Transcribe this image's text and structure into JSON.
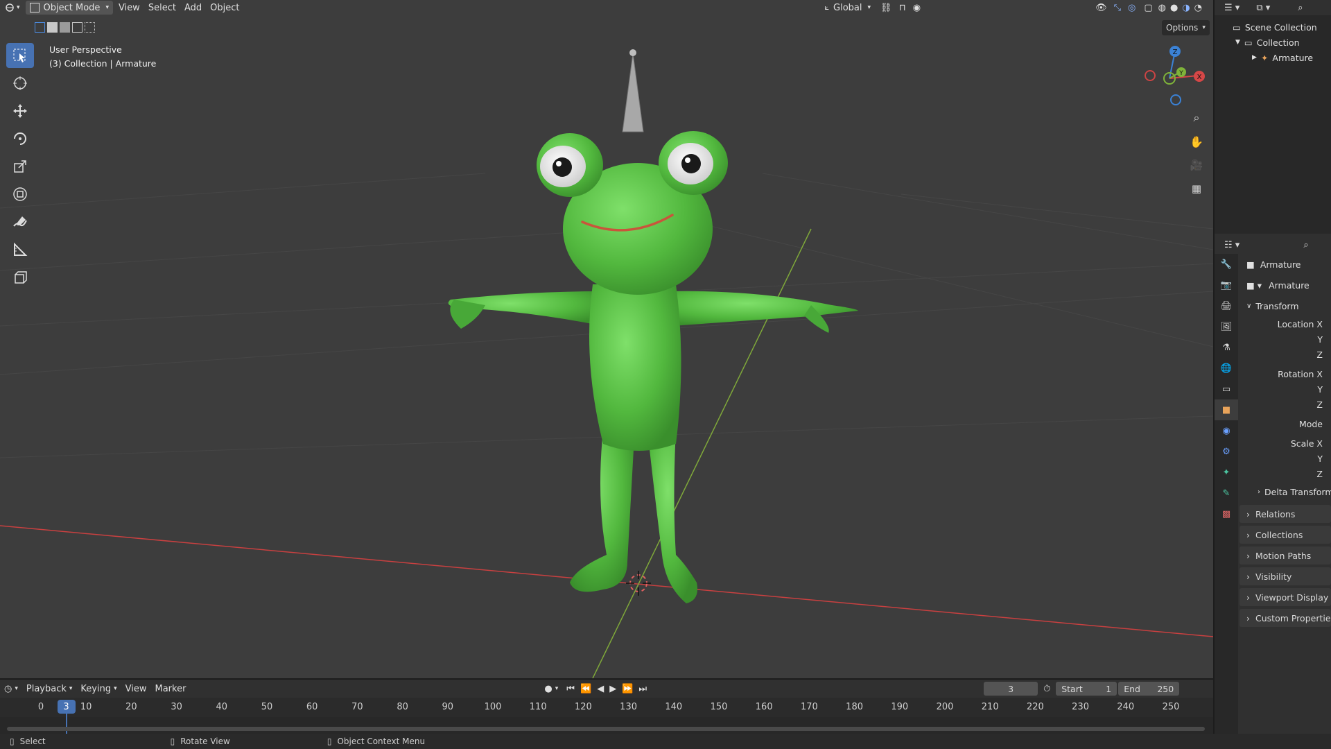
{
  "header": {
    "editor_icon": "editor-type-icon",
    "mode": "Object Mode",
    "menus": [
      "View",
      "Select",
      "Add",
      "Object"
    ],
    "transform_orientation": "Global"
  },
  "viewport": {
    "perspective_label": "User Perspective",
    "context_label": "(3) Collection | Armature",
    "options_label": "Options",
    "gizmo": {
      "x": "X",
      "y": "Y",
      "z": "Z"
    }
  },
  "toolbar": {
    "tools": [
      "select-box-icon",
      "cursor-icon",
      "move-icon",
      "rotate-icon",
      "scale-icon",
      "transform-icon",
      "annotate-icon",
      "measure-icon",
      "add-cube-icon"
    ]
  },
  "outliner": {
    "rows": [
      "Scene Collection",
      "Collection",
      "Armature"
    ]
  },
  "properties": {
    "object_name": "Armature",
    "data_name": "Armature",
    "transform_label": "Transform",
    "fields": [
      {
        "label": "Location X"
      },
      {
        "label": "Y"
      },
      {
        "label": "Z"
      },
      {
        "label": "Rotation X"
      },
      {
        "label": "Y"
      },
      {
        "label": "Z"
      },
      {
        "label": "Mode"
      },
      {
        "label": "Scale X"
      },
      {
        "label": "Y"
      },
      {
        "label": "Z"
      }
    ],
    "delta_transform": "Delta Transform",
    "panels": [
      "Relations",
      "Collections",
      "Motion Paths",
      "Visibility",
      "Viewport Display",
      "Custom Properties"
    ]
  },
  "timeline": {
    "menus": [
      "Playback",
      "Keying",
      "View",
      "Marker"
    ],
    "current_frame": "3",
    "start_label": "Start",
    "start_value": "1",
    "end_label": "End",
    "end_value": "250",
    "ticks": [
      "0",
      "10",
      "20",
      "30",
      "40",
      "50",
      "60",
      "70",
      "80",
      "90",
      "100",
      "110",
      "120",
      "130",
      "140",
      "150",
      "160",
      "170",
      "180",
      "190",
      "200",
      "210",
      "220",
      "230",
      "240",
      "250"
    ],
    "playhead": "3"
  },
  "status": {
    "items": [
      "Select",
      "Rotate View",
      "Object Context Menu"
    ]
  },
  "colors": {
    "accent": "#4772b3",
    "frog_green": "#5ec64a",
    "x_axis": "#c94040",
    "y_axis": "#7fa83a"
  }
}
